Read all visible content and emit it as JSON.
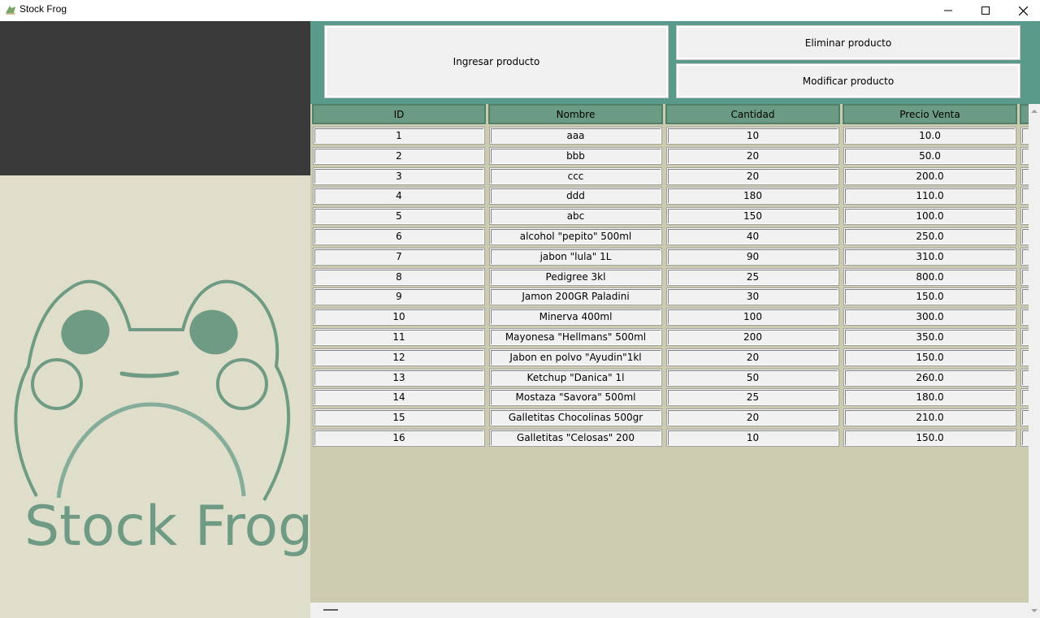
{
  "window": {
    "title": "Stock Frog",
    "icon": "frog-app-icon",
    "controls": [
      "minimize-icon",
      "maximize-icon",
      "close-icon"
    ]
  },
  "logo": {
    "text": "Stock Frog",
    "color": "#6f9b85"
  },
  "toolbar": {
    "ingresar_label": "Ingresar producto",
    "eliminar_label": "Eliminar producto",
    "modificar_label": "Modificar producto"
  },
  "table": {
    "columns": [
      "ID",
      "Nombre",
      "Cantidad",
      "Precio Venta"
    ],
    "rows": [
      [
        "1",
        "aaa",
        "10",
        "10.0"
      ],
      [
        "2",
        "bbb",
        "20",
        "50.0"
      ],
      [
        "3",
        "ccc",
        "20",
        "200.0"
      ],
      [
        "4",
        "ddd",
        "180",
        "110.0"
      ],
      [
        "5",
        "abc",
        "150",
        "100.0"
      ],
      [
        "6",
        "alcohol \"pepito\" 500ml",
        "40",
        "250.0"
      ],
      [
        "7",
        "jabon \"lula\" 1L",
        "90",
        "310.0"
      ],
      [
        "8",
        "Pedigree 3kl",
        "25",
        "800.0"
      ],
      [
        "9",
        "Jamon 200GR Paladini",
        "30",
        "150.0"
      ],
      [
        "10",
        "Minerva 400ml",
        "100",
        "300.0"
      ],
      [
        "11",
        "Mayonesa \"Hellmans\" 500ml",
        "200",
        "350.0"
      ],
      [
        "12",
        "Jabon en polvo \"Ayudin\"1kl",
        "20",
        "150.0"
      ],
      [
        "13",
        "Ketchup \"Danica\" 1l",
        "50",
        "260.0"
      ],
      [
        "14",
        "Mostaza \"Savora\" 500ml",
        "25",
        "180.0"
      ],
      [
        "15",
        "Galletitas Chocolinas 500gr",
        "20",
        "210.0"
      ],
      [
        "16",
        "Galletitas \"Celosas\" 200",
        "10",
        "150.0"
      ]
    ]
  },
  "colors": {
    "accent": "#5a9a8a",
    "header": "#6b9a85",
    "left_dark": "#3a3a3a",
    "left_light": "#dfdecb",
    "panel_bg": "#cdcbaf"
  }
}
